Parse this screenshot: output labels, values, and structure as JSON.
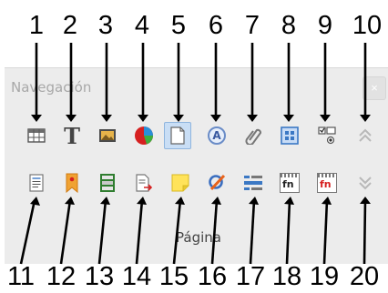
{
  "navigator": {
    "title": "Navegación",
    "close_label": "×",
    "section_label": "Página"
  },
  "callouts": [
    "1",
    "2",
    "3",
    "4",
    "5",
    "6",
    "7",
    "8",
    "9",
    "10",
    "11",
    "12",
    "13",
    "14",
    "15",
    "16",
    "17",
    "18",
    "19",
    "20"
  ],
  "toolbar": {
    "row1": [
      {
        "icon": "table-icon",
        "active": false
      },
      {
        "icon": "text-frame-icon",
        "glyph": "T",
        "active": false
      },
      {
        "icon": "image-icon",
        "active": false
      },
      {
        "icon": "ole-object-icon",
        "active": false
      },
      {
        "icon": "page-icon",
        "active": true
      },
      {
        "icon": "drawing-object-icon",
        "glyph": "A",
        "active": false
      },
      {
        "icon": "link-icon",
        "active": false
      },
      {
        "icon": "frame-icon",
        "active": false
      },
      {
        "icon": "form-control-icon",
        "active": false
      },
      {
        "icon": "previous-arrow-icon",
        "active": false
      }
    ],
    "row2": [
      {
        "icon": "headings-icon",
        "active": false
      },
      {
        "icon": "bookmark-icon",
        "active": false
      },
      {
        "icon": "section-icon",
        "active": false
      },
      {
        "icon": "reference-icon",
        "active": false
      },
      {
        "icon": "comment-icon",
        "active": false
      },
      {
        "icon": "drawing-icon",
        "active": false
      },
      {
        "icon": "field-icon",
        "active": false
      },
      {
        "icon": "footnote-icon",
        "glyph": "fn",
        "active": false
      },
      {
        "icon": "endnote-icon",
        "glyph": "fn",
        "active": false
      },
      {
        "icon": "next-arrow-icon",
        "active": false
      }
    ]
  },
  "colors": {
    "panel_bg": "#ececec",
    "active_bg": "#c9def5",
    "callout_text": "#000000"
  }
}
